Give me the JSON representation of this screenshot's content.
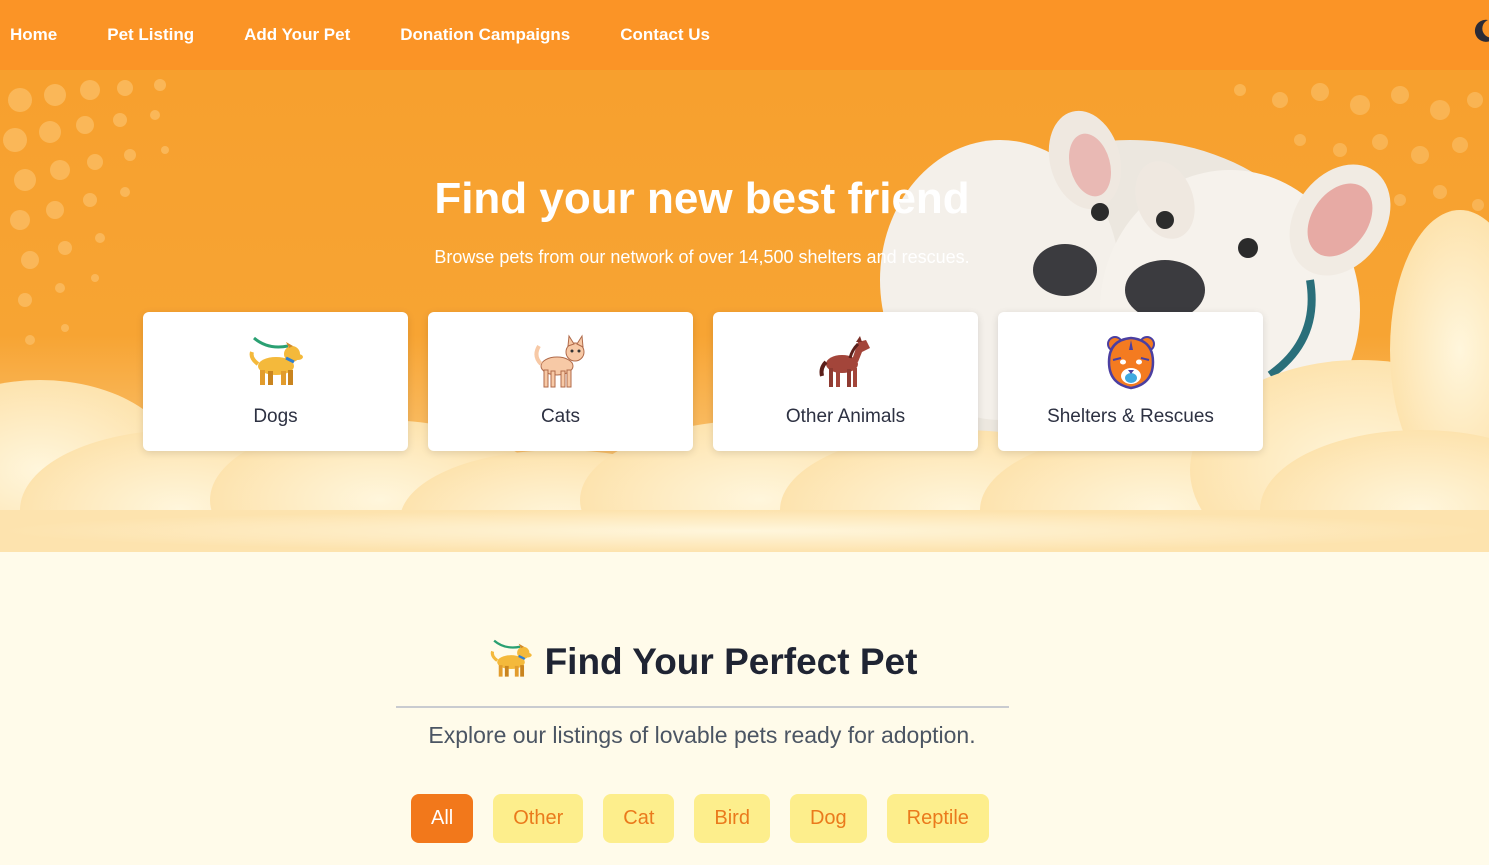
{
  "nav": {
    "items": [
      {
        "label": "Home"
      },
      {
        "label": "Pet Listing"
      },
      {
        "label": "Add Your Pet"
      },
      {
        "label": "Donation Campaigns"
      },
      {
        "label": "Contact Us"
      }
    ],
    "theme_toggle_icon": "moon-icon"
  },
  "hero": {
    "title": "Find your new best friend",
    "subtitle": "Browse pets from our network of over 14,500 shelters and rescues.",
    "cards": [
      {
        "label": "Dogs",
        "icon": "dog-icon"
      },
      {
        "label": "Cats",
        "icon": "cat-icon"
      },
      {
        "label": "Other Animals",
        "icon": "horse-icon"
      },
      {
        "label": "Shelters & Rescues",
        "icon": "tiger-icon"
      }
    ]
  },
  "section": {
    "title": "Find Your Perfect Pet",
    "title_icon": "dog-icon",
    "subtitle": "Explore our listings of lovable pets ready for adoption.",
    "filters": [
      {
        "label": "All",
        "active": true
      },
      {
        "label": "Other",
        "active": false
      },
      {
        "label": "Cat",
        "active": false
      },
      {
        "label": "Bird",
        "active": false
      },
      {
        "label": "Dog",
        "active": false
      },
      {
        "label": "Reptile",
        "active": false
      }
    ]
  },
  "colors": {
    "nav_bg": "#fb9426",
    "hero_bg": "#f7a02e",
    "page_bg": "#fffbea",
    "filter_active_bg": "#f2781b",
    "filter_bg": "#fdee8c",
    "filter_text": "#ea7a1c"
  }
}
